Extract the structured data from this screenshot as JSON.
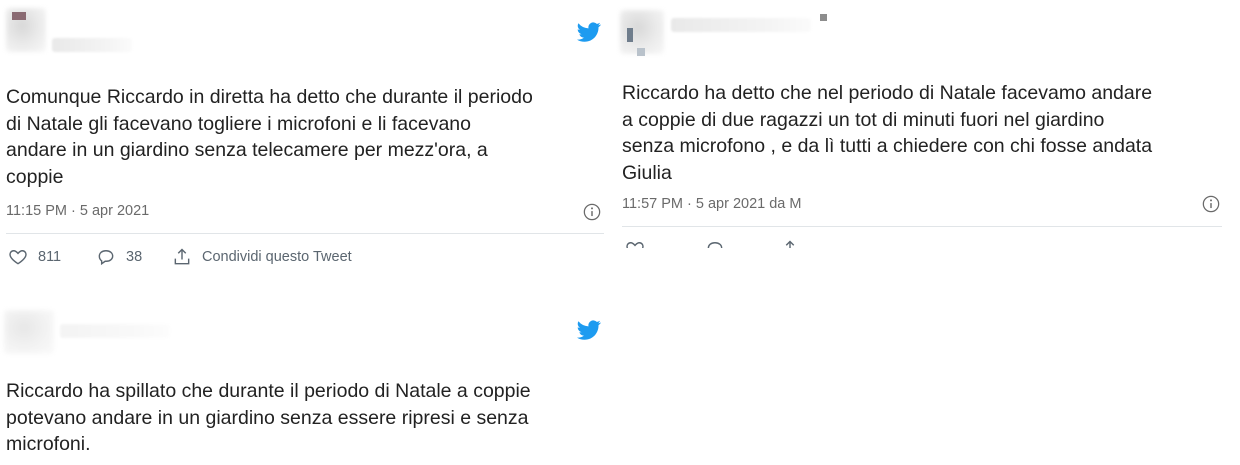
{
  "tweets": [
    {
      "text": "Comunque Riccardo in diretta ha detto che durante il periodo\ndi Natale gli facevano togliere i microfoni e li facevano\nandare in un giardino senza telecamere per mezz'ora, a\ncoppie",
      "timestamp": "11:15 PM · 5 apr 2021",
      "likes": "811",
      "replies": "38",
      "share_label": "Condividi questo Tweet",
      "icons": [
        "twitter-bird-icon",
        "info-icon",
        "heart-icon",
        "reply-icon",
        "share-icon"
      ]
    },
    {
      "text": "Riccardo ha detto che nel periodo di Natale facevamo andare\na coppie di due ragazzi un tot di minuti fuori nel giardino\nsenza microfono , e da lì tutti a chiedere con chi fosse andata\nGiulia",
      "timestamp": "11:57 PM · 5 apr 2021 da M",
      "icons": [
        "info-icon",
        "heart-icon",
        "reply-icon",
        "share-icon"
      ]
    },
    {
      "text": "Riccardo ha spillato che durante il periodo di Natale a coppie\npotevano andare in un giardino senza essere ripresi e senza\nmicrofoni.",
      "icons": [
        "twitter-bird-icon"
      ]
    }
  ],
  "colors": {
    "twitter_blue": "#1d9bf0",
    "text": "#222222",
    "muted": "#6a6a6a",
    "separator": "#e1e5e8"
  }
}
